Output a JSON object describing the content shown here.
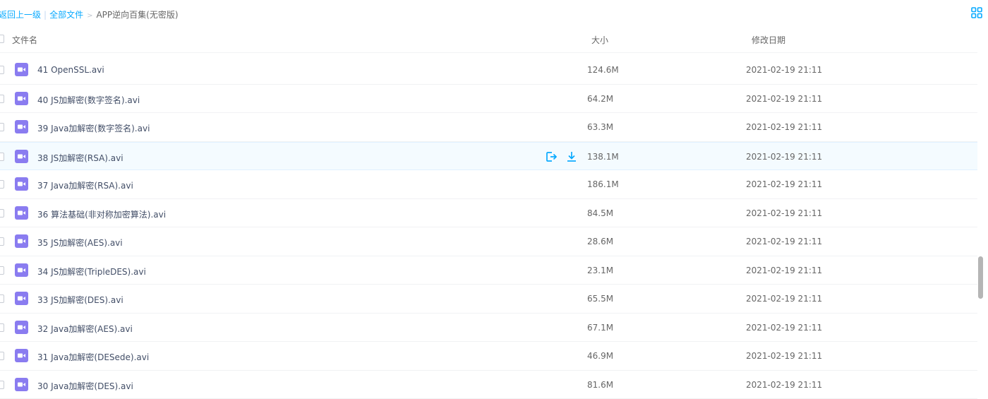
{
  "breadcrumb": {
    "back": "返回上一级",
    "all_files": "全部文件",
    "separator": "|",
    "current": "APP逆向百集(无密版)"
  },
  "table_header": {
    "name": "文件名",
    "size": "大小",
    "modified": "修改日期"
  },
  "files": [
    {
      "name": "41 OpenSSL.avi",
      "size": "124.6M",
      "date": "2021-02-19 21:11"
    },
    {
      "name": "40 JS加解密(数字签名).avi",
      "size": "64.2M",
      "date": "2021-02-19 21:11"
    },
    {
      "name": "39 Java加解密(数字签名).avi",
      "size": "63.3M",
      "date": "2021-02-19 21:11"
    },
    {
      "name": "38 JS加解密(RSA).avi",
      "size": "138.1M",
      "date": "2021-02-19 21:11"
    },
    {
      "name": "37 Java加解密(RSA).avi",
      "size": "186.1M",
      "date": "2021-02-19 21:11"
    },
    {
      "name": "36 算法基础(非对称加密算法).avi",
      "size": "84.5M",
      "date": "2021-02-19 21:11"
    },
    {
      "name": "35 JS加解密(AES).avi",
      "size": "28.6M",
      "date": "2021-02-19 21:11"
    },
    {
      "name": "34 JS加解密(TripleDES).avi",
      "size": "23.1M",
      "date": "2021-02-19 21:11"
    },
    {
      "name": "33 JS加解密(DES).avi",
      "size": "65.5M",
      "date": "2021-02-19 21:11"
    },
    {
      "name": "32 Java加解密(AES).avi",
      "size": "67.1M",
      "date": "2021-02-19 21:11"
    },
    {
      "name": "31 Java加解密(DESede).avi",
      "size": "46.9M",
      "date": "2021-02-19 21:11"
    },
    {
      "name": "30 Java加解密(DES).avi",
      "size": "81.6M",
      "date": "2021-02-19 21:11"
    }
  ],
  "icons": {
    "file_type": "video-file-icon",
    "row_actions": [
      "share-icon",
      "download-icon"
    ],
    "view_toggle": "grid-view-icon"
  },
  "colors": {
    "link": "#09aaff",
    "video_icon": "#8a7cf0",
    "highlight_row": "#f4fbff"
  }
}
